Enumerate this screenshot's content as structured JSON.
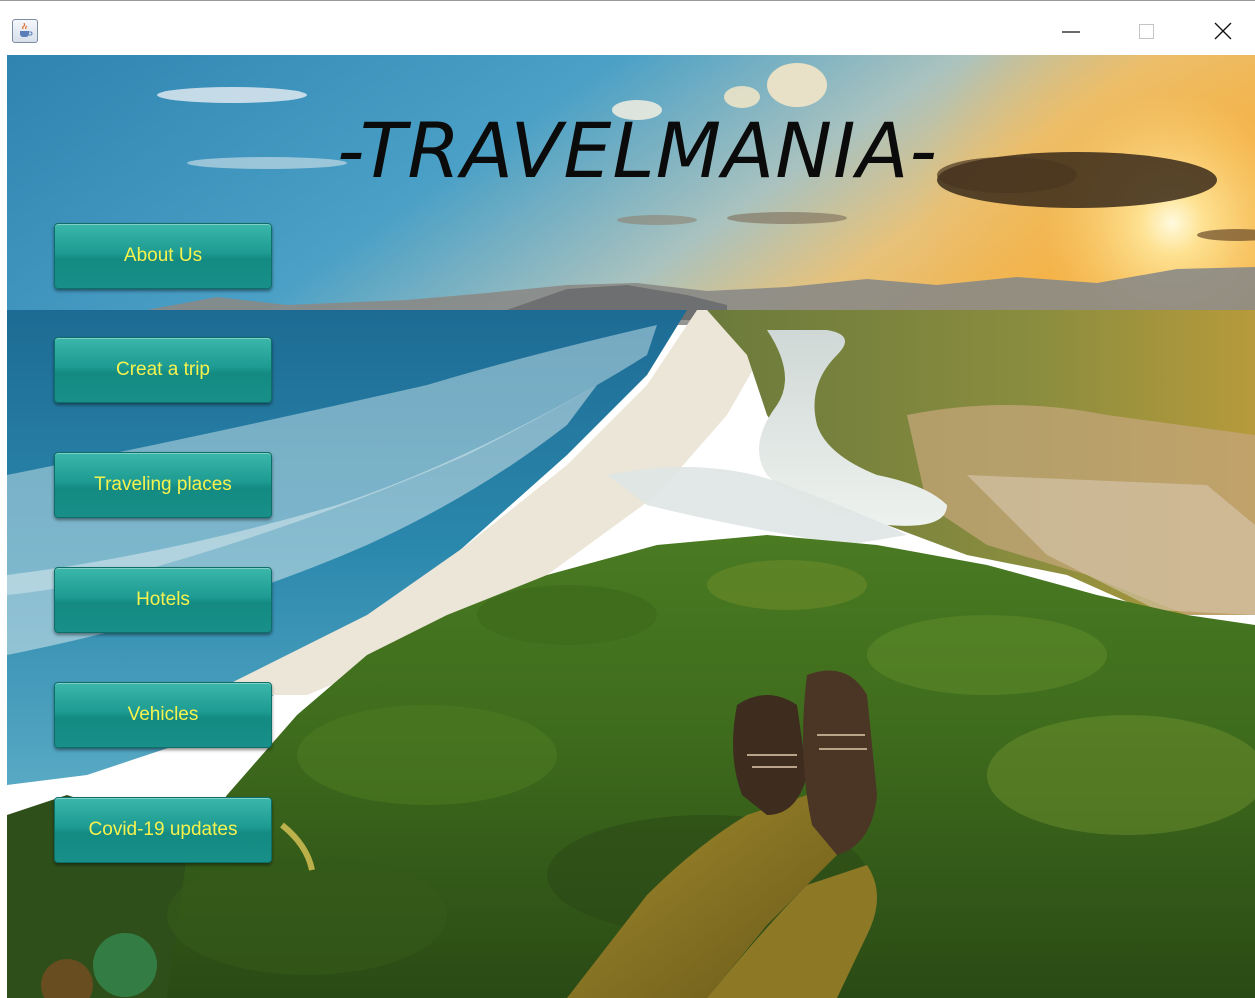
{
  "window": {
    "icon": "java-cup-icon",
    "controls": [
      "minimize-icon",
      "maximize-icon",
      "close-icon"
    ]
  },
  "app": {
    "title": "-TRAVELMANIA-"
  },
  "menu": {
    "about": "About Us",
    "create_trip": "Creat a trip",
    "traveling_places": "Traveling places",
    "hotels": "Hotels",
    "vehicles": "Vehicles",
    "covid": "Covid-19 updates"
  },
  "colors": {
    "button_bg": "#1e9b92",
    "button_text": "#f6f24e",
    "title_text": "#0b0b0b"
  }
}
